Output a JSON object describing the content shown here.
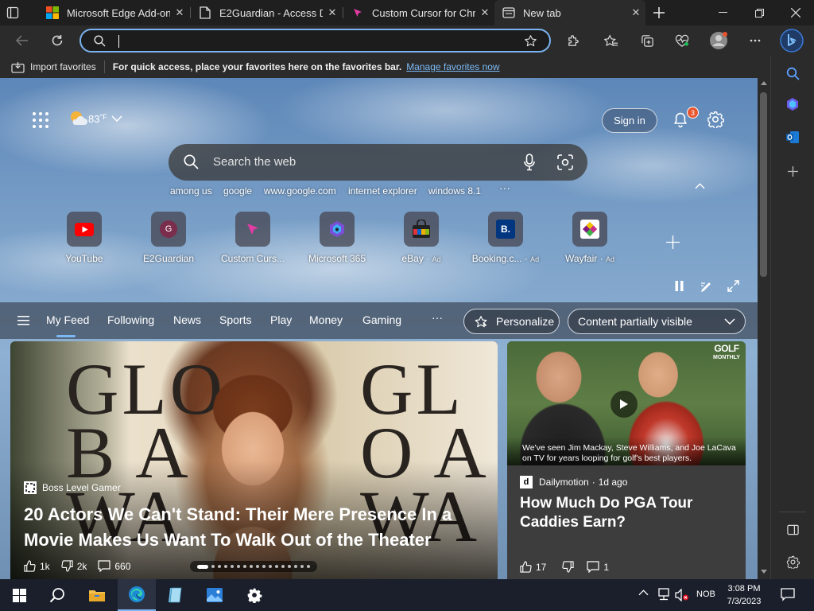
{
  "tabs": [
    {
      "title": "Microsoft Edge Add-ons",
      "icon": "microsoft-logo-icon"
    },
    {
      "title": "E2Guardian - Access Denied",
      "icon": "page-icon"
    },
    {
      "title": "Custom Cursor for Chrome",
      "icon": "cursor-icon"
    },
    {
      "title": "New tab",
      "icon": "newtab-icon"
    }
  ],
  "toolbar": {
    "address_value": ""
  },
  "favorites_bar": {
    "import_label": "Import favorites",
    "hint": "For quick access, place your favorites here on the favorites bar.",
    "manage_link": "Manage favorites now"
  },
  "header": {
    "temperature": "83",
    "temp_unit": "°F",
    "sign_in": "Sign in",
    "notification_count": "3"
  },
  "search": {
    "placeholder": "Search the web",
    "suggestions": [
      "among us",
      "google",
      "www.google.com",
      "internet explorer",
      "windows 8.1"
    ]
  },
  "quick_links": [
    {
      "label": "YouTube",
      "ad": "",
      "icon": "youtube-icon"
    },
    {
      "label": "E2Guardian",
      "ad": "",
      "icon": "e2guardian-icon",
      "letter": "G"
    },
    {
      "label": "Custom Curs...",
      "ad": "",
      "icon": "cursor-icon"
    },
    {
      "label": "Microsoft 365",
      "ad": "",
      "icon": "m365-icon"
    },
    {
      "label": "eBay",
      "ad": "Ad",
      "icon": "ebay-icon"
    },
    {
      "label": "Booking.c...",
      "ad": "Ad",
      "icon": "booking-icon",
      "letter": "B."
    },
    {
      "label": "Wayfair",
      "ad": "Ad",
      "icon": "wayfair-icon"
    }
  ],
  "feed_tabs": [
    "My Feed",
    "Following",
    "News",
    "Sports",
    "Play",
    "Money",
    "Gaming"
  ],
  "feed_more": "···",
  "personalize_label": "Personalize",
  "content_visibility": "Content partially visible",
  "main_story": {
    "source": "Boss Level Gamer",
    "headline": "20 Actors We Can't Stand: Their Mere Presence In a Movie Makes Us Want To Walk Out of the Theater",
    "likes": "1k",
    "dislikes": "2k",
    "comments": "660",
    "bg_text_left": "GLOB AWA",
    "bg_text_right": "GLO AWA"
  },
  "side_story": {
    "source": "Dailymotion",
    "time": "1d ago",
    "headline": "How Much Do PGA Tour Caddies Earn?",
    "caption": "We've seen Jim Mackay, Steve Williams, and Joe LaCava on TV for years looping for golf's best players.",
    "brand": "GOLF",
    "brand_sub": "MONTHLY",
    "likes": "17",
    "comments": "1"
  },
  "taskbar": {
    "time": "3:08 PM",
    "date": "7/3/2023",
    "lang": "NOB"
  },
  "colors": {
    "accent": "#7ab3ef",
    "link": "#7cb9f4",
    "badge": "#e8552f"
  }
}
